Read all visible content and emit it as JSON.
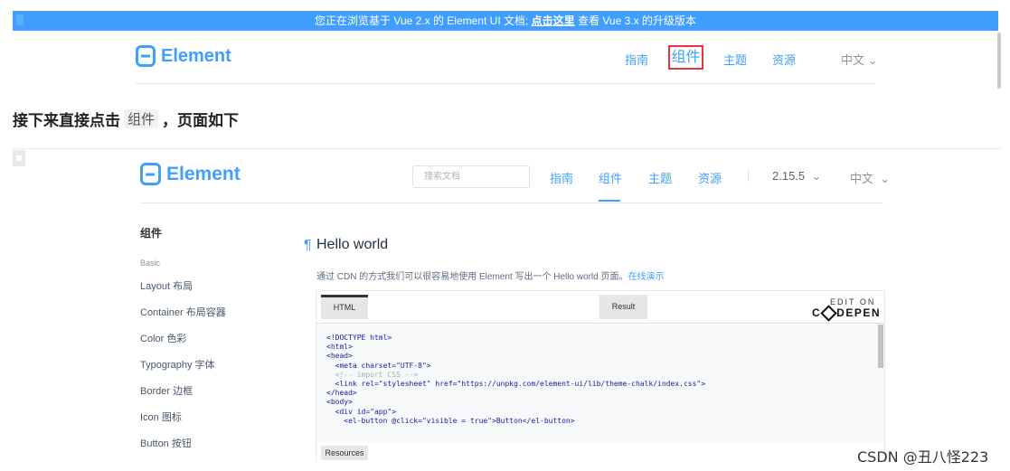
{
  "colors": {
    "brand": "#409eff",
    "highlight_box": "#e6363a"
  },
  "banner": {
    "pre_text": "您正在浏览基于 Vue 2.x 的 Element UI 文档; ",
    "link_text": "点击这里",
    "post_text": " 查看 Vue 3.x 的升级版本"
  },
  "header1": {
    "logo_text": "Element",
    "nav": {
      "guide": "指南",
      "component": "组件",
      "theme": "主题",
      "resource": "资源",
      "language": "中文"
    }
  },
  "article": {
    "pre_text": "接下来直接点击",
    "code_text": "组件",
    "post_text": "，页面如下"
  },
  "header2": {
    "logo_text": "Element",
    "search_placeholder": "搜索文档",
    "nav": {
      "guide": "指南",
      "component": "组件",
      "theme": "主题",
      "resource": "资源",
      "version": "2.15.5",
      "language": "中文"
    }
  },
  "sidebar": {
    "title": "组件",
    "group_label": "Basic",
    "items": [
      "Layout 布局",
      "Container 布局容器",
      "Color 色彩",
      "Typography 字体",
      "Border 边框",
      "Icon 图标",
      "Button 按钮"
    ]
  },
  "main": {
    "pilcrow": "¶",
    "title": "Hello world",
    "desc_text": "通过 CDN 的方式我们可以很容易地使用 Element 写出一个 Hello world 页面。",
    "desc_link": "在线演示"
  },
  "codepen": {
    "tab_html": "HTML",
    "tab_result": "Result",
    "edit_on": "EDIT ON",
    "brand_left": "C",
    "brand_right": "DEPEN",
    "resources": "Resources",
    "code_lines": [
      "<!DOCTYPE html>",
      "<html>",
      "<head>",
      "  <meta charset=\"UTF-8\">",
      "  <!-- import CSS -->",
      "  <link rel=\"stylesheet\" href=\"https://unpkg.com/element-ui/lib/theme-chalk/index.css\">",
      "</head>",
      "<body>",
      "  <div id=\"app\">",
      "    <el-button @click=\"visible = true\">Button</el-button>"
    ]
  },
  "watermark": "CSDN @丑八怪223"
}
